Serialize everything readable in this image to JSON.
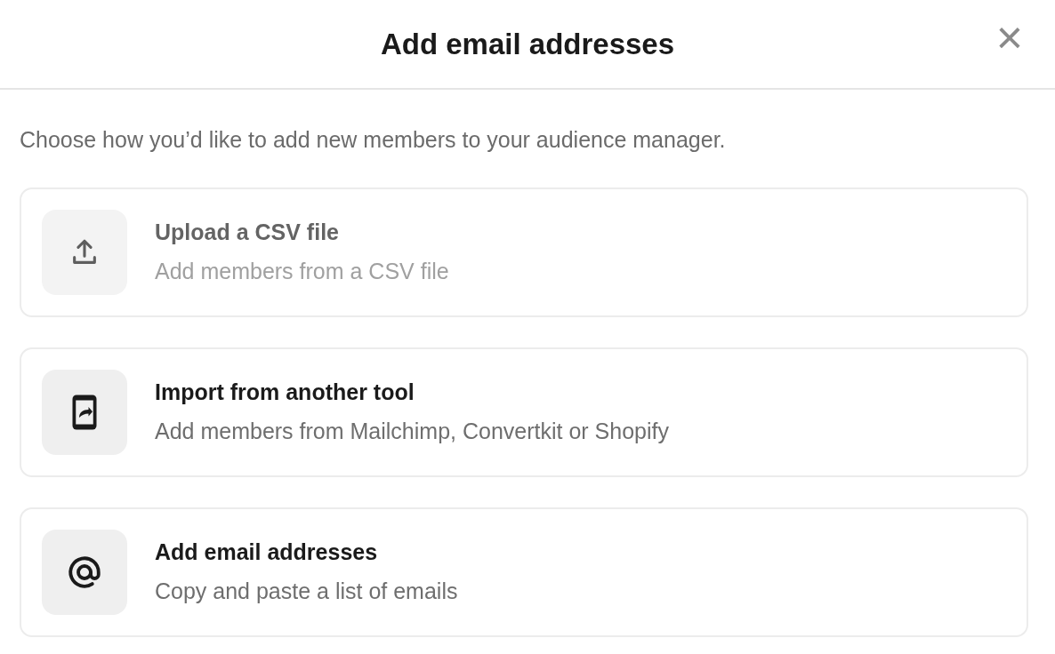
{
  "dialog": {
    "title": "Add email addresses",
    "close": "×"
  },
  "intro": "Choose how you’d like to add new members to your audience manager.",
  "options": [
    {
      "kind": "upload",
      "title": "Upload a CSV file",
      "description": "Add members from a CSV file",
      "disabled": true
    },
    {
      "kind": "import",
      "title": "Import from another tool",
      "description": "Add members from Mailchimp, Convertkit or Shopify",
      "disabled": false
    },
    {
      "kind": "email",
      "title": "Add email addresses",
      "description": "Copy and paste a list of emails",
      "disabled": false
    }
  ]
}
